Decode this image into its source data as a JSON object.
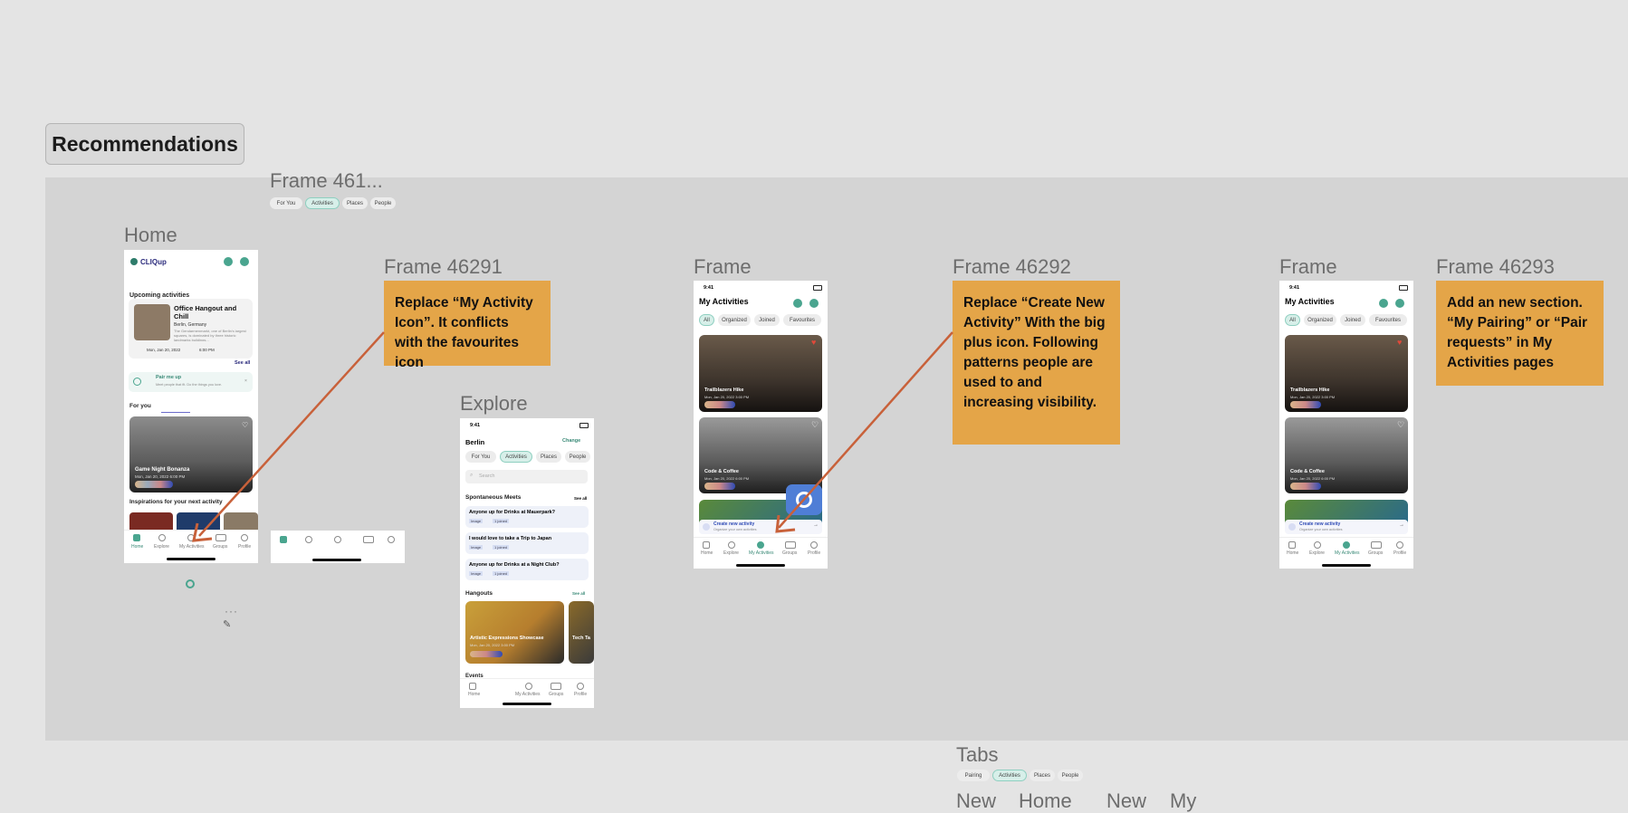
{
  "top_button": "Recommendations",
  "frames": {
    "frame461": "Frame 461...",
    "home": "Home",
    "frame46291": "Frame 46291",
    "explore": "Explore",
    "frame_a": "Frame",
    "frame46292": "Frame 46292",
    "frame_b": "Frame",
    "frame46293": "Frame 46293",
    "tabs": "Tabs"
  },
  "notes": {
    "n1": "Replace “My Activity Icon”. It conflicts with the favourites icon",
    "n2": "Replace “Create New Activity” With the big plus icon. Following patterns people are used to and increasing visibility.",
    "n3": "Add an new section. “My Pairing” or “Pair requests” in My Activities pages"
  },
  "frame461_chips": [
    "For You",
    "Activities",
    "Places",
    "People"
  ],
  "tabs_chips": [
    "Pairing",
    "Activities",
    "Places",
    "People"
  ],
  "tabs_cut_labels": [
    "New",
    "Home",
    "New",
    "My"
  ],
  "status_time": "9:41",
  "home": {
    "brand": "CLIQup",
    "upcoming_title": "Upcoming activities",
    "event_title": "Office Hangout and Chill",
    "event_location": "Berlin, Germany",
    "event_desc": "The Gendarmenmarkt, one of Berlin's largest squares, is dominated by three historic landmarks buildings...",
    "event_date": "Mon, Jan 20, 2022",
    "event_time": "6:00 PM",
    "see_all": "See all",
    "pair_title": "Pair me up",
    "pair_sub": "Meet people that fit. Do the things you love.",
    "for_you": "For you",
    "card_title": "Game Night Bonanza",
    "card_date": "Mon, Jan 20, 2022 6:00 PM",
    "inspirations": "Inspirations for your next activity"
  },
  "nav_items": [
    "Home",
    "Explore",
    "My Activities",
    "Groups",
    "Profile"
  ],
  "explore": {
    "city": "Berlin",
    "change": "Change",
    "chips": [
      "For You",
      "Activities",
      "Places",
      "People"
    ],
    "search_placeholder": "Search",
    "spontaneous": "Spontaneous Meets",
    "see_all": "See all",
    "meets": [
      {
        "title": "Anyone up for Drinks at Mauerpark?",
        "tag1": "Image",
        "tag2": "1 joined"
      },
      {
        "title": "I would love to take a Trip to Japan",
        "tag1": "Image",
        "tag2": "1 joined"
      },
      {
        "title": "Anyone up for Drinks at a Night Club?",
        "tag1": "Image",
        "tag2": "1 joined"
      }
    ],
    "hangouts": "Hangouts",
    "hangout_card": "Artistic Expressions Showcase",
    "hangout_date": "Mon, Jan 20, 2022 3:00 PM",
    "hangout_card2": "Tech Ta",
    "events": "Events",
    "nav": [
      "Home",
      "My Activities",
      "Groups",
      "Profile"
    ]
  },
  "my_activities": {
    "title": "My Activities",
    "chips": [
      "All",
      "Organized",
      "Joined",
      "Favourites"
    ],
    "card1_title": "Trailblazers Hike",
    "card1_date": "Mon, Jan 20, 2022 3:00 PM",
    "card2_title": "Code & Coffee",
    "card2_date": "Mon, Jan 20, 2022 6:00 PM",
    "create_title": "Create new activity",
    "create_sub": "Organize your own activities",
    "more_count": "+3"
  },
  "colors": {
    "note": "#e4a548",
    "arrow": "#c8613a",
    "accent": "#4aa58f",
    "canvas": "#d4d4d4",
    "background": "#e4e4e4"
  }
}
